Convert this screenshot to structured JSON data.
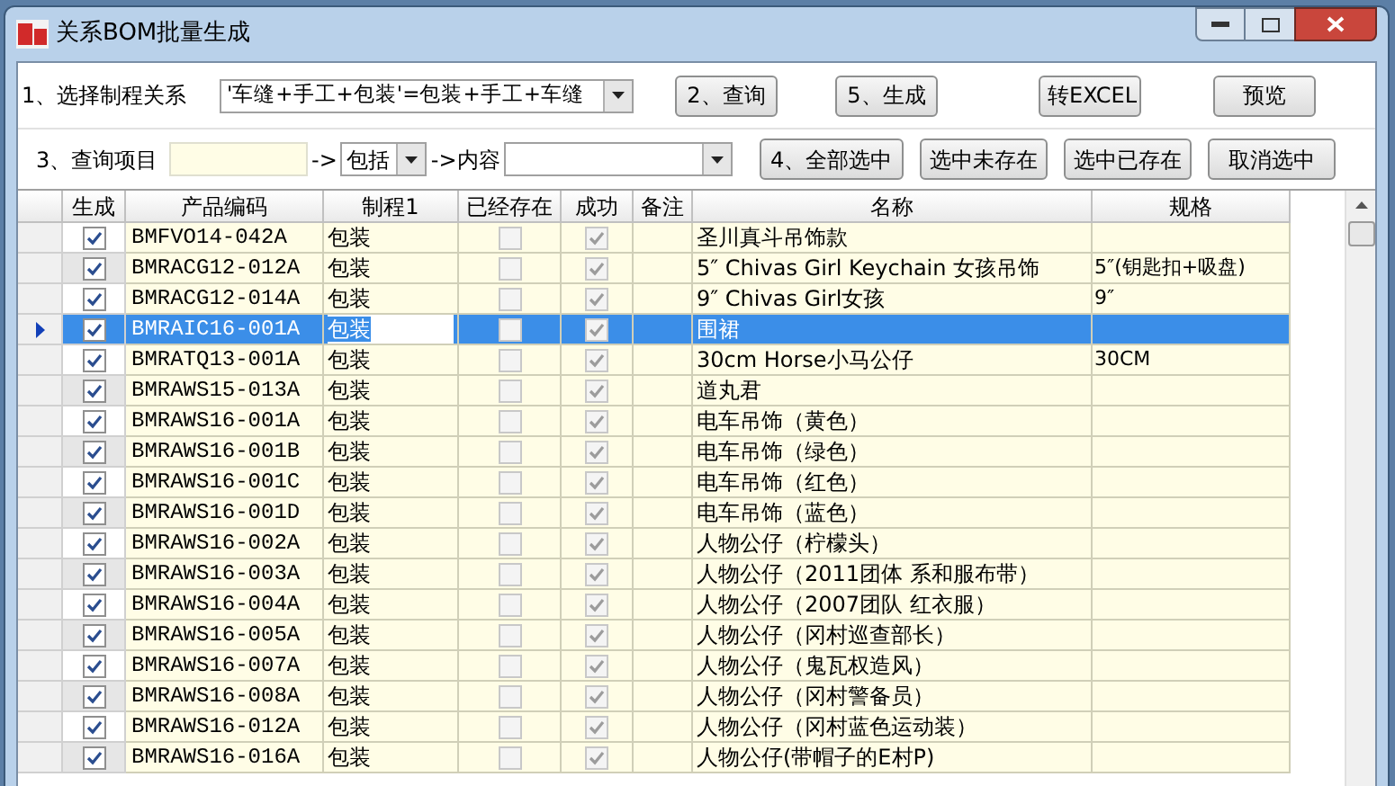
{
  "window": {
    "title": "关系BOM批量生成"
  },
  "toolbar": {
    "relation_label": "1、选择制程关系",
    "relation_value": "'车缝+手工+包装'=包装+手工+车缝",
    "query_label": "3、查询项目",
    "arrow_1": "->",
    "match_value": "包括",
    "arrow_2": "->内容",
    "buttons_top": [
      "2、查询",
      "5、生成",
      "转EXCEL",
      "预览"
    ],
    "buttons_bottom": [
      "4、全部选中",
      "选中未存在",
      "选中已存在",
      "取消选中"
    ]
  },
  "table": {
    "columns": [
      "生成",
      "产品编码",
      "制程1",
      "已经存在",
      "成功",
      "备注",
      "名称",
      "规格"
    ],
    "rows": [
      {
        "generate": true,
        "code": "BMFVO14-042A",
        "process": "包装",
        "exists": false,
        "success": true,
        "name": "圣川真斗吊饰款",
        "selected": false
      },
      {
        "generate": true,
        "code": "BMRACG12-012A",
        "process": "包装",
        "exists": false,
        "success": true,
        "name": "5″ Chivas Girl Keychain 女孩吊饰",
        "spec": "5″(钥匙扣+吸盘)",
        "selected": false
      },
      {
        "generate": true,
        "code": "BMRACG12-014A",
        "process": "包装",
        "exists": false,
        "success": true,
        "name": "9″ Chivas Girl女孩",
        "spec": "9″",
        "selected": false
      },
      {
        "generate": true,
        "code": "BMRAIC16-001A",
        "process": "包装",
        "exists": false,
        "success": true,
        "name": "围裙",
        "selected": true
      },
      {
        "generate": true,
        "code": "BMRATQ13-001A",
        "process": "包装",
        "exists": false,
        "success": true,
        "name": "30cm Horse小马公仔",
        "spec": "30CM",
        "selected": false
      },
      {
        "generate": true,
        "code": "BMRAWS15-013A",
        "process": "包装",
        "exists": false,
        "success": true,
        "name": "道丸君",
        "selected": false
      },
      {
        "generate": true,
        "code": "BMRAWS16-001A",
        "process": "包装",
        "exists": false,
        "success": true,
        "name": "电车吊饰（黄色）",
        "selected": false
      },
      {
        "generate": true,
        "code": "BMRAWS16-001B",
        "process": "包装",
        "exists": false,
        "success": true,
        "name": "电车吊饰（绿色）",
        "selected": false
      },
      {
        "generate": true,
        "code": "BMRAWS16-001C",
        "process": "包装",
        "exists": false,
        "success": true,
        "name": "电车吊饰（红色）",
        "selected": false
      },
      {
        "generate": true,
        "code": "BMRAWS16-001D",
        "process": "包装",
        "exists": false,
        "success": true,
        "name": "电车吊饰（蓝色）",
        "selected": false
      },
      {
        "generate": true,
        "code": "BMRAWS16-002A",
        "process": "包装",
        "exists": false,
        "success": true,
        "name": "人物公仔（柠檬头）",
        "selected": false
      },
      {
        "generate": true,
        "code": "BMRAWS16-003A",
        "process": "包装",
        "exists": false,
        "success": true,
        "name": "人物公仔（2011团体 系和服布带）",
        "selected": false
      },
      {
        "generate": true,
        "code": "BMRAWS16-004A",
        "process": "包装",
        "exists": false,
        "success": true,
        "name": "人物公仔（2007团队 红衣服）",
        "selected": false
      },
      {
        "generate": true,
        "code": "BMRAWS16-005A",
        "process": "包装",
        "exists": false,
        "success": true,
        "name": "人物公仔（冈村巡查部长）",
        "selected": false
      },
      {
        "generate": true,
        "code": "BMRAWS16-007A",
        "process": "包装",
        "exists": false,
        "success": true,
        "name": "人物公仔（鬼瓦权造风）",
        "selected": false
      },
      {
        "generate": true,
        "code": "BMRAWS16-008A",
        "process": "包装",
        "exists": false,
        "success": true,
        "name": "人物公仔（冈村警备员）",
        "selected": false
      },
      {
        "generate": true,
        "code": "BMRAWS16-012A",
        "process": "包装",
        "exists": false,
        "success": true,
        "name": "人物公仔（冈村蓝色运动装）",
        "selected": false
      },
      {
        "generate": true,
        "code": "BMRAWS16-016A",
        "process": "包装",
        "exists": false,
        "success": true,
        "name": "人物公仔(带帽子的E村P)",
        "selected": false
      }
    ]
  }
}
